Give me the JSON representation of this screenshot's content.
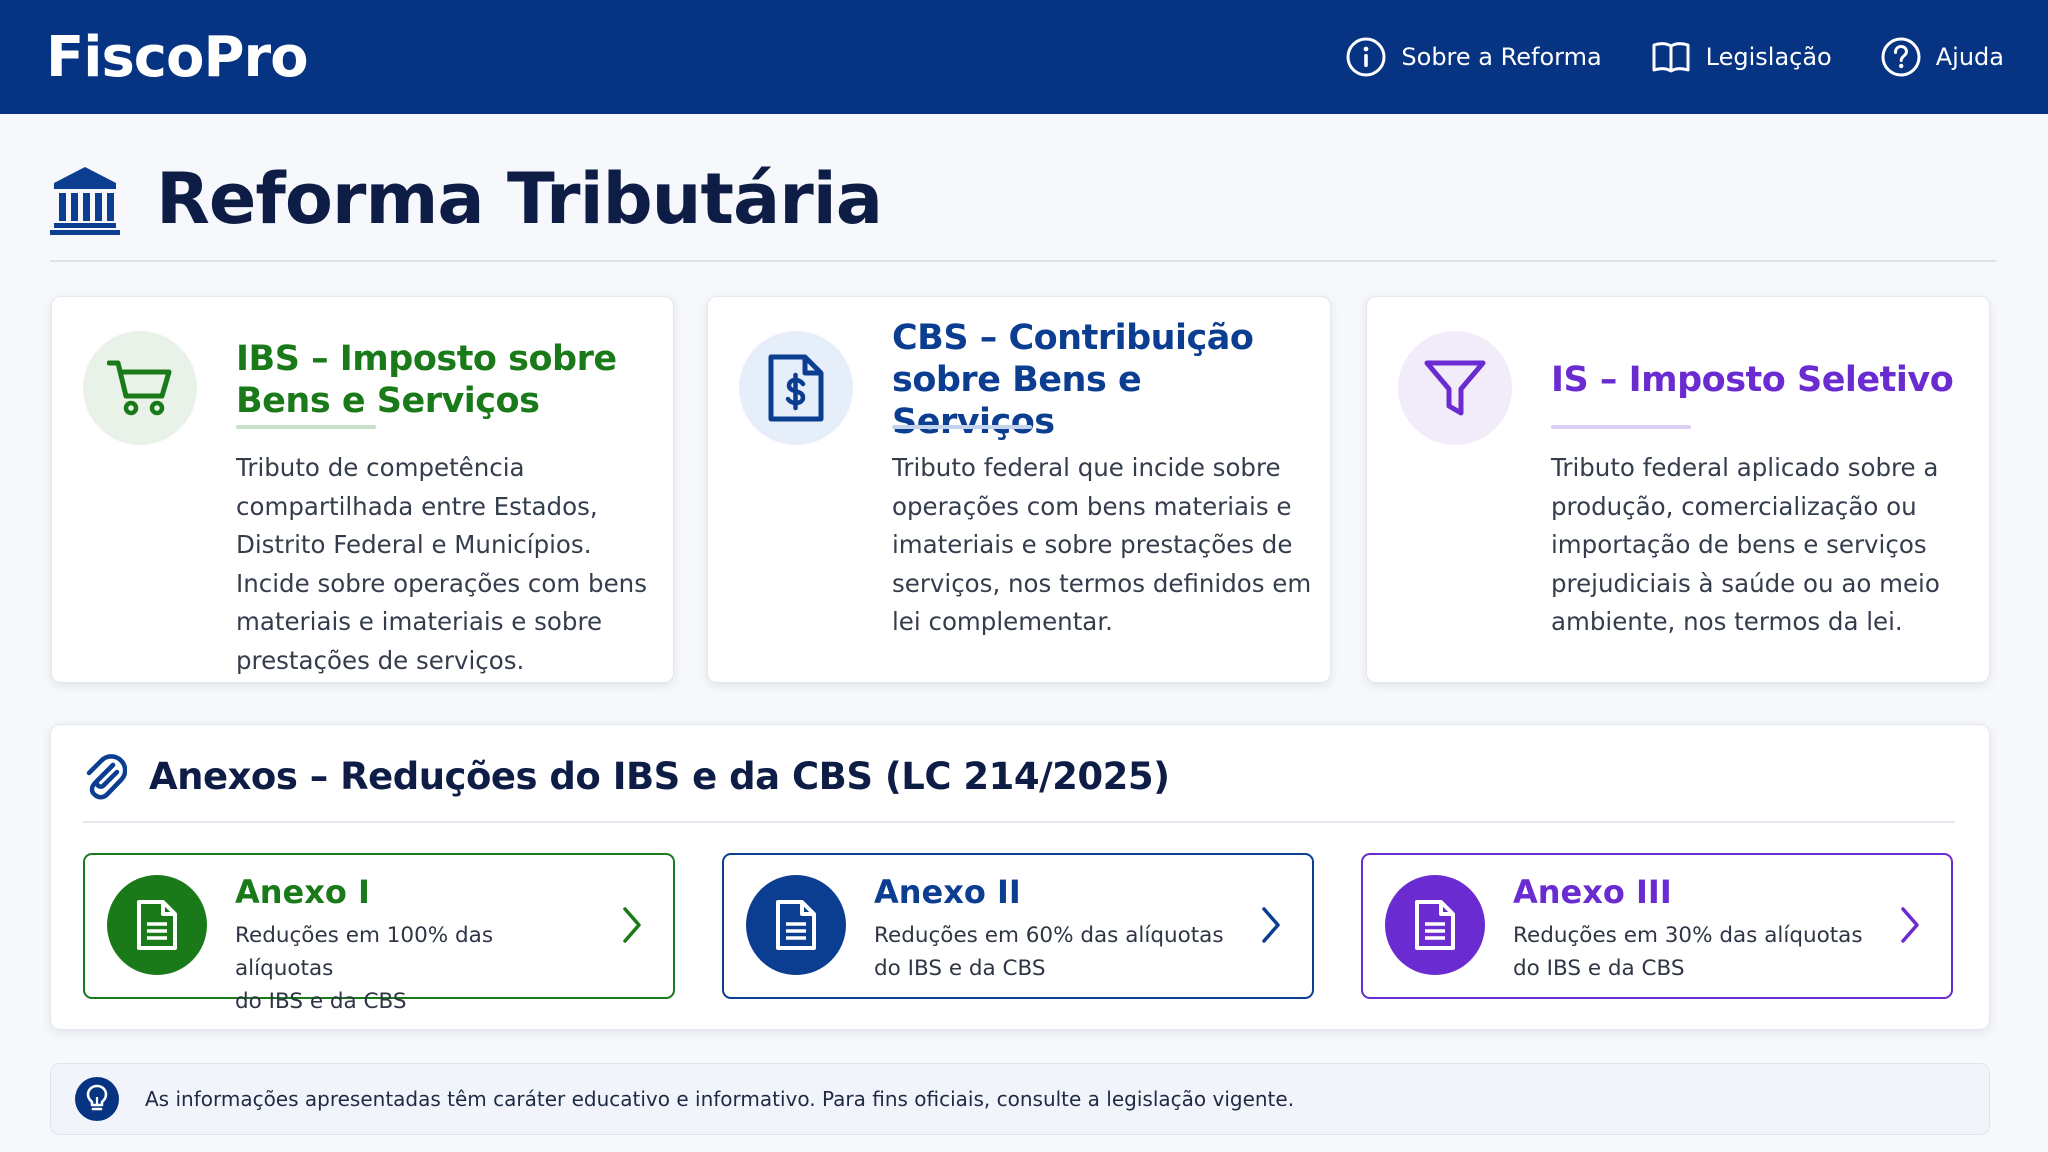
{
  "header": {
    "brand": "FiscoPro",
    "nav": [
      {
        "label": "Sobre a Reforma",
        "icon": "info-icon"
      },
      {
        "label": "Legislação",
        "icon": "book-icon"
      },
      {
        "label": "Ajuda",
        "icon": "help-icon"
      }
    ]
  },
  "page": {
    "title": "Reforma Tributária",
    "icon": "bank-icon"
  },
  "taxes": [
    {
      "title_line1": "IBS – Imposto sobre",
      "title_line2": "Bens e Serviços",
      "description": "Tributo de competência compartilhada entre Estados, Distrito Federal e Municípios. Incide sobre operações com bens materiais e imateriais e sobre prestações de serviços.",
      "icon": "shopping-cart-icon",
      "color": "#1a7a1a"
    },
    {
      "title_line1": "CBS – Contribuição",
      "title_line2": "sobre Bens e Serviços",
      "description": "Tributo federal que incide sobre operações com bens materiais e imateriais e sobre prestações de serviços, nos termos definidos em lei complementar.",
      "icon": "dollar-document-icon",
      "color": "#0b3d91"
    },
    {
      "title_line1": "IS – Imposto Seletivo",
      "title_line2": "",
      "description": "Tributo federal aplicado sobre a produção, comercialização ou importação de bens e serviços prejudiciais à saúde ou ao meio ambiente, nos termos da lei.",
      "icon": "funnel-icon",
      "color": "#6a2bd0"
    }
  ],
  "annexes": {
    "title": "Anexos – Reduções do IBS e da CBS (LC 214/2025)",
    "icon": "paperclip-icon",
    "items": [
      {
        "name": "Anexo I",
        "line1": "Reduções em 100% das alíquotas",
        "line2": "do IBS e da CBS",
        "color": "#1a7a1a"
      },
      {
        "name": "Anexo II",
        "line1": "Reduções em 60% das alíquotas",
        "line2": "do IBS e da CBS",
        "color": "#0b3d91"
      },
      {
        "name": "Anexo III",
        "line1": "Reduções em 30% das alíquotas",
        "line2": "do IBS e da CBS",
        "color": "#6a2bd0"
      }
    ]
  },
  "info": {
    "text": "As informações apresentadas têm caráter educativo e informativo. Para fins oficiais, consulte a legislação vigente.",
    "icon": "lightbulb-icon"
  },
  "colors": {
    "header_bg": "#063382",
    "green": "#1a7a1a",
    "blue": "#0b3d91",
    "purple": "#6a2bd0"
  }
}
